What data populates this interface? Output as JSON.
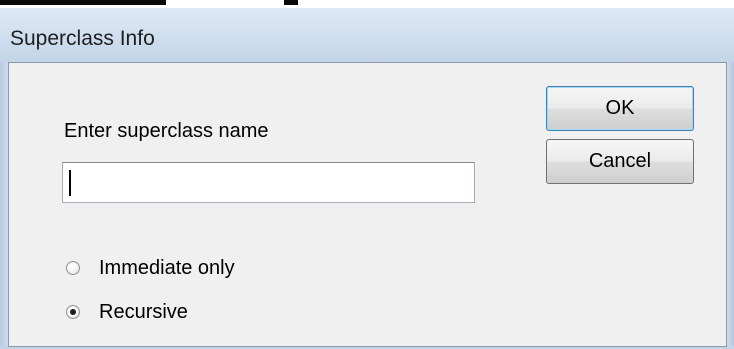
{
  "window": {
    "title": "Superclass Info"
  },
  "form": {
    "prompt_label": "Enter superclass name",
    "name_input": {
      "value": "",
      "placeholder": ""
    }
  },
  "buttons": {
    "ok_label": "OK",
    "cancel_label": "Cancel"
  },
  "options": {
    "items": [
      {
        "label": "Immediate only",
        "selected": false
      },
      {
        "label": "Recursive",
        "selected": true
      }
    ]
  },
  "colors": {
    "title_bar": "#cfdeee",
    "dialog_background": "#f0f0f0",
    "default_button_border": "#3c7fb1"
  },
  "icons": {
    "unselected_radio": "radio-unselected-icon",
    "selected_radio": "radio-selected-icon"
  }
}
